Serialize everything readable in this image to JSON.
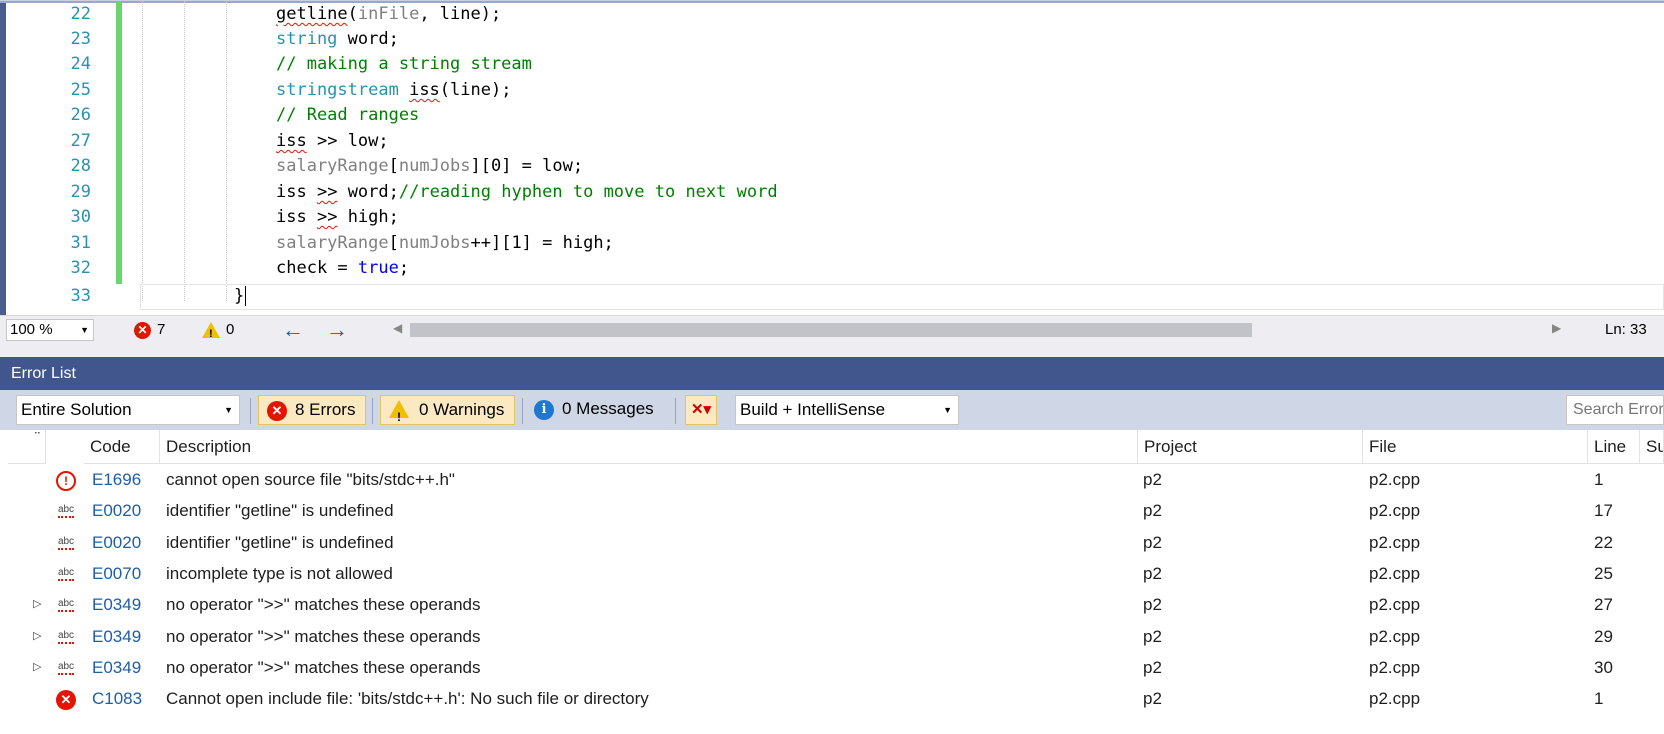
{
  "editor": {
    "lines": [
      {
        "num": "22"
      },
      {
        "num": "23"
      },
      {
        "num": "24"
      },
      {
        "num": "25"
      },
      {
        "num": "26"
      },
      {
        "num": "27"
      },
      {
        "num": "28"
      },
      {
        "num": "29"
      },
      {
        "num": "30"
      },
      {
        "num": "31"
      },
      {
        "num": "32"
      },
      {
        "num": "33"
      }
    ],
    "code": {
      "l22_fn": "getline",
      "l22_args_open": "(",
      "l22_arg1": "inFile",
      "l22_rest": ", line);",
      "l23_type": "string",
      "l23_rest": " word;",
      "l24_comment": "// making a string stream",
      "l25_type": "stringstream",
      "l25_sp": " ",
      "l25_var": "iss",
      "l25_rest": "(line);",
      "l26_comment": "// Read ranges",
      "l27_var": "iss",
      "l27_sp": " ",
      "l27_op": ">>",
      "l27_rest": " low;",
      "l28_arr": "salaryRange",
      "l28_b1": "[",
      "l28_idx": "numJobs",
      "l28_rest": "][0] = low;",
      "l29_var": "iss",
      "l29_sp": " ",
      "l29_op": ">>",
      "l29_rest": " word;",
      "l29_comment": "//reading hyphen to move to next word",
      "l30_var": "iss",
      "l30_sp": " ",
      "l30_op": ">>",
      "l30_rest": " high;",
      "l31_arr": "salaryRange",
      "l31_b1": "[",
      "l31_idx": "numJobs",
      "l31_rest": "++][1] = high;",
      "l32_pre": "check = ",
      "l32_kw": "true",
      "l32_semi": ";",
      "l33_brace": "}"
    }
  },
  "status": {
    "zoom": "100 %",
    "error_count": "7",
    "warning_count": "0",
    "ln": "Ln: 33"
  },
  "error_list": {
    "title": "Error List",
    "scope": "Entire Solution",
    "errors_label": "8 Errors",
    "warnings_label": "0 Warnings",
    "messages_label": "0 Messages",
    "build_filter": "Build + IntelliSense",
    "search_placeholder": "Search Error",
    "columns": {
      "code": "Code",
      "description": "Description",
      "project": "Project",
      "file": "File",
      "line": "Line",
      "suppression": "Su"
    },
    "rows": [
      {
        "icon": "error-outline-icon",
        "expandable": false,
        "code": "E1696",
        "description": "cannot open source file \"bits/stdc++.h\"",
        "project": "p2",
        "file": "p2.cpp",
        "line": "1"
      },
      {
        "icon": "intellisense-icon",
        "expandable": false,
        "code": "E0020",
        "description": "identifier \"getline\" is undefined",
        "project": "p2",
        "file": "p2.cpp",
        "line": "17"
      },
      {
        "icon": "intellisense-icon",
        "expandable": false,
        "code": "E0020",
        "description": "identifier \"getline\" is undefined",
        "project": "p2",
        "file": "p2.cpp",
        "line": "22"
      },
      {
        "icon": "intellisense-icon",
        "expandable": false,
        "code": "E0070",
        "description": "incomplete type is not allowed",
        "project": "p2",
        "file": "p2.cpp",
        "line": "25"
      },
      {
        "icon": "intellisense-icon",
        "expandable": true,
        "code": "E0349",
        "description": "no operator \">>\" matches these operands",
        "project": "p2",
        "file": "p2.cpp",
        "line": "27"
      },
      {
        "icon": "intellisense-icon",
        "expandable": true,
        "code": "E0349",
        "description": "no operator \">>\" matches these operands",
        "project": "p2",
        "file": "p2.cpp",
        "line": "29"
      },
      {
        "icon": "intellisense-icon",
        "expandable": true,
        "code": "E0349",
        "description": "no operator \">>\" matches these operands",
        "project": "p2",
        "file": "p2.cpp",
        "line": "30"
      },
      {
        "icon": "error-filled-icon",
        "expandable": false,
        "code": "C1083",
        "description": "Cannot open include file: 'bits/stdc++.h': No such file or directory",
        "project": "p2",
        "file": "p2.cpp",
        "line": "1"
      }
    ]
  },
  "colors": {
    "accent": "#40568d",
    "error": "#e51400",
    "warning": "#f0c000",
    "info": "#1e78d2",
    "changed_lines": "#6cd46c"
  }
}
